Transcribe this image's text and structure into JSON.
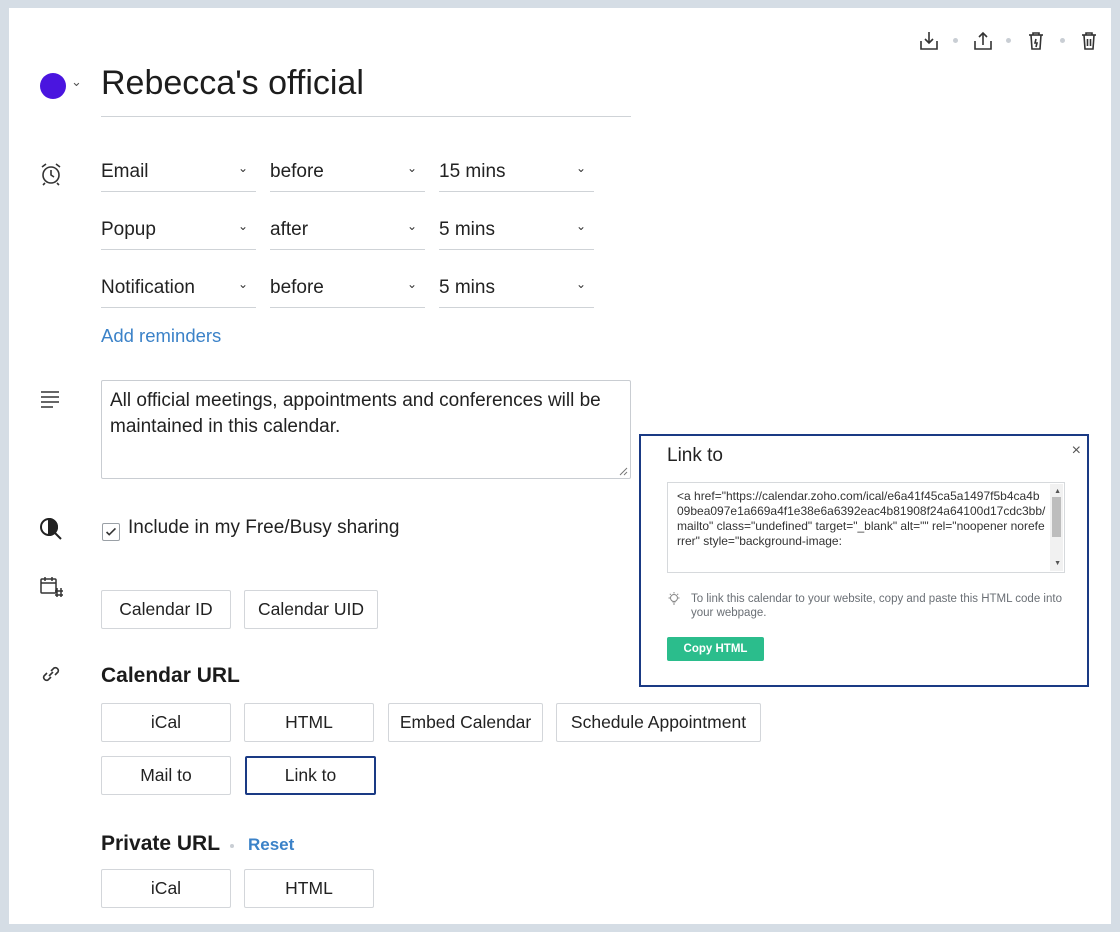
{
  "toolbar": {
    "icons": [
      "download-icon",
      "share-icon",
      "clear-icon",
      "delete-icon"
    ]
  },
  "calendar": {
    "title": "Rebecca's official",
    "color": "#4a15df"
  },
  "reminders": [
    {
      "type": "Email",
      "when": "before",
      "time": "15 mins"
    },
    {
      "type": "Popup",
      "when": "after",
      "time": "5 mins"
    },
    {
      "type": "Notification",
      "when": "before",
      "time": "5 mins"
    }
  ],
  "add_reminders_label": "Add reminders",
  "description": "All official meetings, appointments and conferences will be maintained in this calendar.",
  "free_busy": {
    "label": "Include in my Free/Busy sharing",
    "checked": true
  },
  "id_buttons": {
    "calendar_id": "Calendar ID",
    "calendar_uid": "Calendar UID"
  },
  "calendar_url": {
    "heading": "Calendar URL",
    "ical": "iCal",
    "html": "HTML",
    "embed": "Embed Calendar",
    "schedule": "Schedule Appointment",
    "mailto": "Mail to",
    "linkto": "Link to"
  },
  "private_url": {
    "heading": "Private URL",
    "reset": "Reset",
    "ical": "iCal",
    "html": "HTML"
  },
  "popup": {
    "title": "Link to",
    "close": "×",
    "code": "<a href=\"https://calendar.zoho.com/ical/e6a41f45ca5a1497f5b4ca4b09bea097e1a669a4f1e38e6a6392eac4b81908f24a64100d17cdc3bb/mailto\" class=\"undefined\" target=\"_blank\" alt=\"\" rel=\"noopener noreferrer\" style=\"background-image:",
    "hint": "To link this calendar to your website, copy and paste this HTML code into your webpage.",
    "copy_label": "Copy HTML"
  },
  "colors": {
    "accent_link": "#3b82c8",
    "active_border": "#1a3a84",
    "copy_button": "#2bbd8c"
  }
}
